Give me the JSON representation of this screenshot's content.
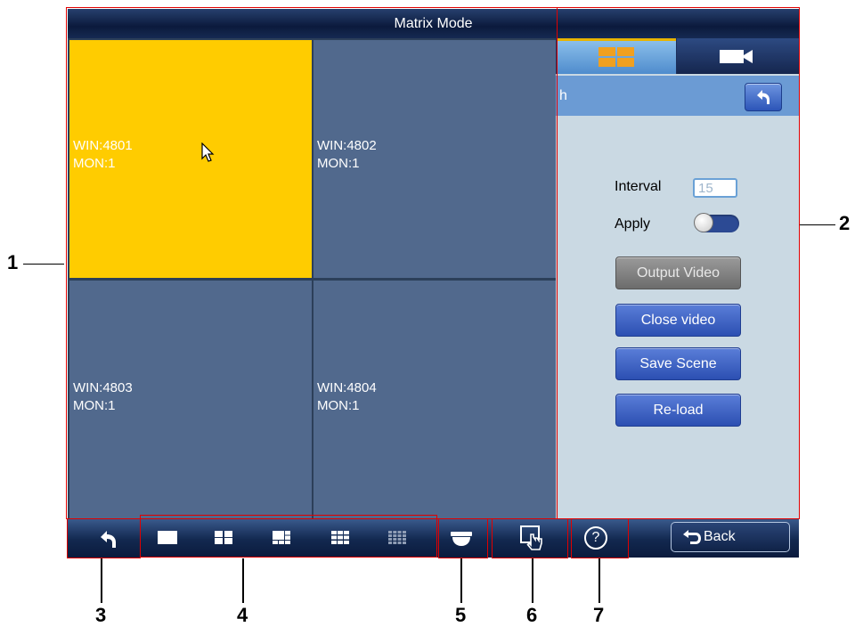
{
  "title": "Matrix Mode",
  "windows": [
    {
      "win": "WIN:4801",
      "mon": "MON:1",
      "selected": true
    },
    {
      "win": "WIN:4802",
      "mon": "MON:1",
      "selected": false
    },
    {
      "win": "WIN:4803",
      "mon": "MON:1",
      "selected": false
    },
    {
      "win": "WIN:4804",
      "mon": "MON:1",
      "selected": false
    }
  ],
  "panel": {
    "tabs": [
      {
        "icon": "window-layout-icon",
        "active": true
      },
      {
        "icon": "camera-icon",
        "active": false
      }
    ],
    "subhead_text": "h",
    "interval_label": "Interval",
    "interval_value": "15",
    "apply_label": "Apply",
    "apply_on": false,
    "buttons": {
      "output_video": "Output Video",
      "close_video": "Close video",
      "save_scene": "Save Scene",
      "reload": "Re-load"
    }
  },
  "toolbar": {
    "layouts": [
      "1-split",
      "4-split",
      "6-split",
      "9-split",
      "16-split"
    ],
    "help_glyph": "?",
    "back_label": "Back"
  },
  "callouts": [
    "1",
    "2",
    "3",
    "4",
    "5",
    "6",
    "7"
  ],
  "colors": {
    "selected_window": "#ffcc00",
    "window": "#51698d",
    "annotation": "#e00000",
    "button": "#3a5fc4"
  }
}
